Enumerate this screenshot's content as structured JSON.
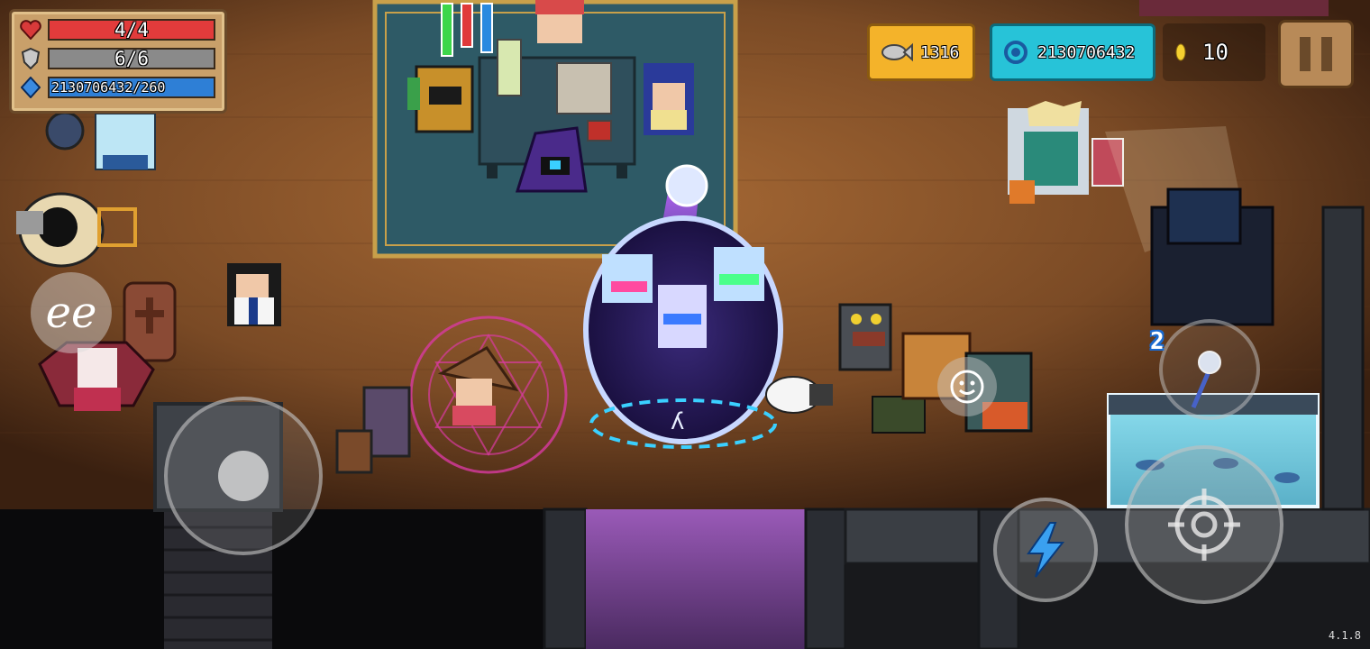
{
  "hud": {
    "hp_text": "4/4",
    "hp_fraction": 1.0,
    "armor_text": "6/6",
    "armor_fraction": 1.0,
    "energy_text": "2130706432/260",
    "energy_fraction": 1.0
  },
  "currency": {
    "fish_icon": "fish-icon",
    "fish": "1316",
    "gems_icon": "gem-icon",
    "gems": "2130706432",
    "coins_icon": "coin-icon",
    "coins": "10"
  },
  "controls": {
    "pause_icon": "pause-icon",
    "emote_label": "ee",
    "weapon_count": "2",
    "skill_icon": "lightning-icon",
    "attack_icon": "crosshair-icon"
  },
  "version": "4.1.8",
  "colors": {
    "hp": "#e23b3b",
    "armor": "#8a8a8a",
    "energy": "#2e7fd6",
    "fish_badge": "#f4b32a",
    "gem_badge": "#27c3d8"
  }
}
